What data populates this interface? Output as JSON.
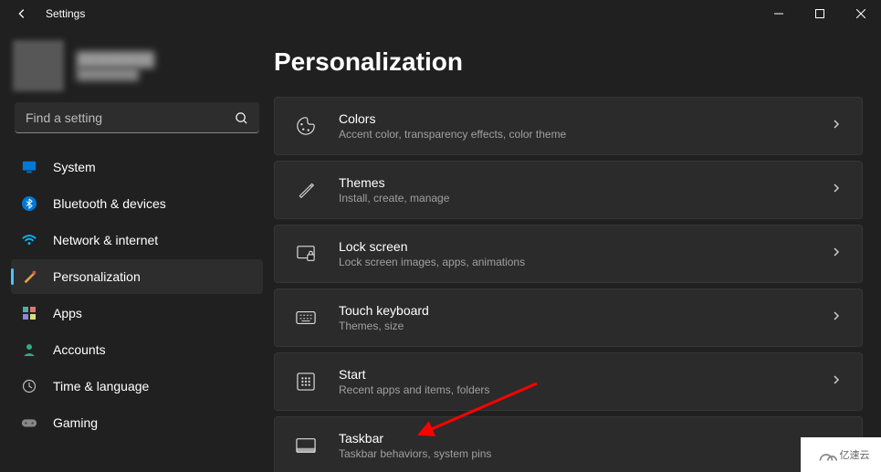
{
  "window": {
    "title": "Settings"
  },
  "profile": {
    "name_placeholder": "████████",
    "email_placeholder": "████████"
  },
  "search": {
    "placeholder": "Find a setting"
  },
  "sidebar": {
    "items": [
      {
        "label": "System",
        "icon": "monitor"
      },
      {
        "label": "Bluetooth & devices",
        "icon": "bluetooth"
      },
      {
        "label": "Network & internet",
        "icon": "wifi"
      },
      {
        "label": "Personalization",
        "icon": "brush"
      },
      {
        "label": "Apps",
        "icon": "apps"
      },
      {
        "label": "Accounts",
        "icon": "person"
      },
      {
        "label": "Time & language",
        "icon": "clock"
      },
      {
        "label": "Gaming",
        "icon": "gamepad"
      }
    ],
    "active_index": 3
  },
  "page": {
    "title": "Personalization",
    "cards": [
      {
        "title": "Colors",
        "subtitle": "Accent color, transparency effects, color theme",
        "icon": "palette"
      },
      {
        "title": "Themes",
        "subtitle": "Install, create, manage",
        "icon": "pencil"
      },
      {
        "title": "Lock screen",
        "subtitle": "Lock screen images, apps, animations",
        "icon": "lock-monitor"
      },
      {
        "title": "Touch keyboard",
        "subtitle": "Themes, size",
        "icon": "keyboard"
      },
      {
        "title": "Start",
        "subtitle": "Recent apps and items, folders",
        "icon": "start-grid"
      },
      {
        "title": "Taskbar",
        "subtitle": "Taskbar behaviors, system pins",
        "icon": "taskbar"
      }
    ]
  },
  "watermark": "亿速云"
}
